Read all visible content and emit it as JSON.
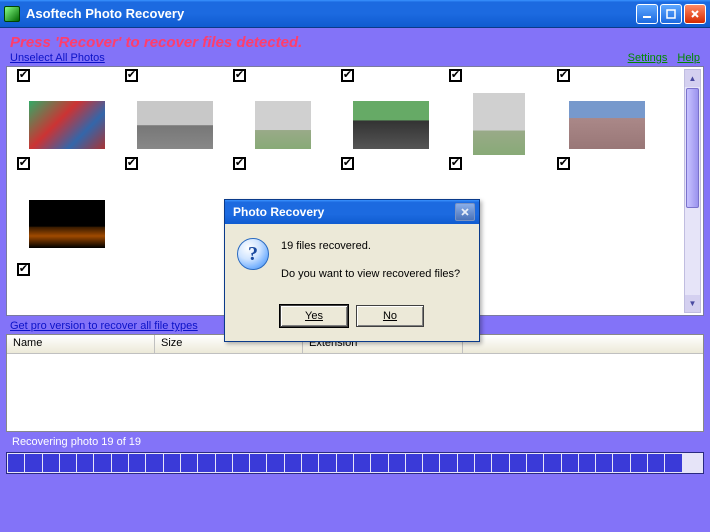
{
  "window": {
    "title": "Asoftech Photo Recovery"
  },
  "header": {
    "instruction": "Press 'Recover' to recover files detected.",
    "unselect_link": "Unselect All Photos",
    "settings_link": "Settings",
    "help_link": "Help"
  },
  "pro_link": "Get pro version to recover all file types",
  "table": {
    "cols": {
      "name": "Name",
      "size": "Size",
      "extension": "Extension"
    }
  },
  "status": {
    "text": "Recovering photo 19 of 19",
    "segments_filled": 39,
    "segments_total": 40
  },
  "dialog": {
    "title": "Photo Recovery",
    "line1": "19 files recovered.",
    "line2": "Do you want to view recovered files?",
    "yes": "Yes",
    "no": "No"
  },
  "thumbs": {
    "row1": [
      {
        "checked": true
      },
      {
        "checked": true
      },
      {
        "checked": true
      },
      {
        "checked": true
      },
      {
        "checked": true
      },
      {
        "checked": true
      }
    ],
    "row2_checked": true
  }
}
